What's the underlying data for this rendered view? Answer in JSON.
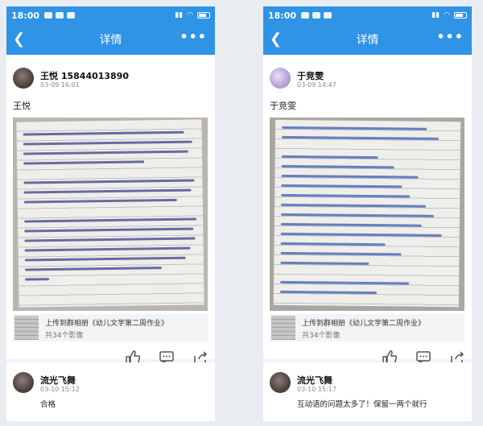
{
  "screens": [
    {
      "status": {
        "time": "18:00"
      },
      "nav": {
        "title": "详情",
        "back": "<",
        "more": "•••"
      },
      "post": {
        "author": "王悦 15844013890",
        "time": "03-09 16:01",
        "text": "王悦",
        "album_line1": "上传到群相册《幼儿文学第二周作业》",
        "album_line2": "共34个影像"
      },
      "comment": {
        "author": "流光飞舞",
        "time": "03-10 15:12",
        "text": "合格"
      }
    },
    {
      "status": {
        "time": "18:00"
      },
      "nav": {
        "title": "详情",
        "back": "<",
        "more": "•••"
      },
      "post": {
        "author": "于竞雯",
        "time": "03-09 14:47",
        "text": "于竞雯",
        "album_line1": "上传到群相册《幼儿文学第二周作业》",
        "album_line2": "共34个影像"
      },
      "comment": {
        "author": "流光飞舞",
        "time": "03-10 15:17",
        "text": "互动语的问题太多了！保留一两个就行"
      }
    }
  ],
  "colors": {
    "accent": "#2f93e6",
    "ink_left": "#3b3f8a",
    "ink_right": "#3a5ab0"
  },
  "icons": [
    "back-icon",
    "more-icon",
    "like-icon",
    "comment-icon",
    "share-icon"
  ]
}
